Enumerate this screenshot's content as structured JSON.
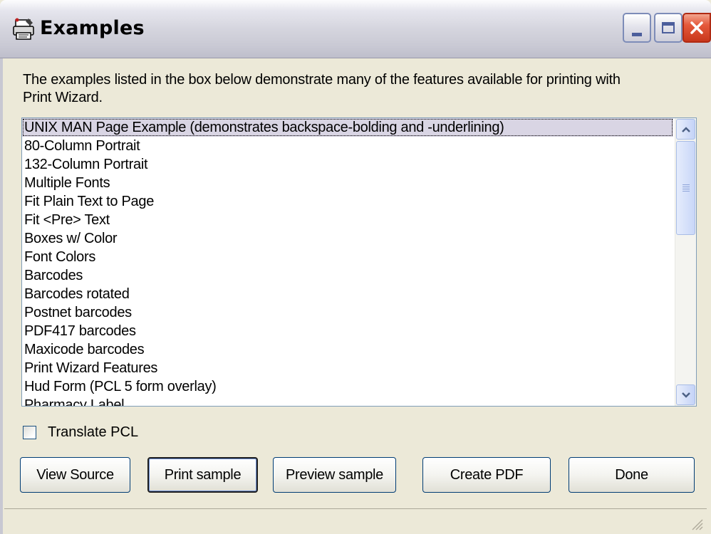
{
  "window": {
    "title": "Examples",
    "title_icon": "printer-wizard-icon"
  },
  "titlebar_buttons": {
    "minimize": "minimize-icon",
    "maximize": "maximize-icon",
    "close": "close-icon"
  },
  "description": "The examples listed in the box below demonstrate many of the features available for printing with Print Wizard.",
  "examples_list": {
    "selected_index": 0,
    "items": [
      "UNIX MAN Page Example (demonstrates backspace-bolding and -underlining)",
      "80-Column Portrait",
      "132-Column Portrait",
      "Multiple Fonts",
      "Fit Plain Text to Page",
      "Fit <Pre> Text",
      "Boxes w/ Color",
      "Font Colors",
      "Barcodes",
      "Barcodes rotated",
      "Postnet barcodes",
      "PDF417 barcodes",
      "Maxicode barcodes",
      "Print Wizard Features",
      "Hud Form (PCL 5 form overlay)",
      "Pharmacy Label"
    ]
  },
  "translate_pcl": {
    "label": "Translate PCL",
    "checked": false
  },
  "buttons": {
    "view_source": "View Source",
    "print_sample": "Print sample",
    "preview_sample": "Preview sample",
    "create_pdf": "Create PDF",
    "done": "Done"
  },
  "colors": {
    "window_bg": "#ECE9D8",
    "selection_bg": "#D9D5E4",
    "close_button": "#E5593B"
  }
}
